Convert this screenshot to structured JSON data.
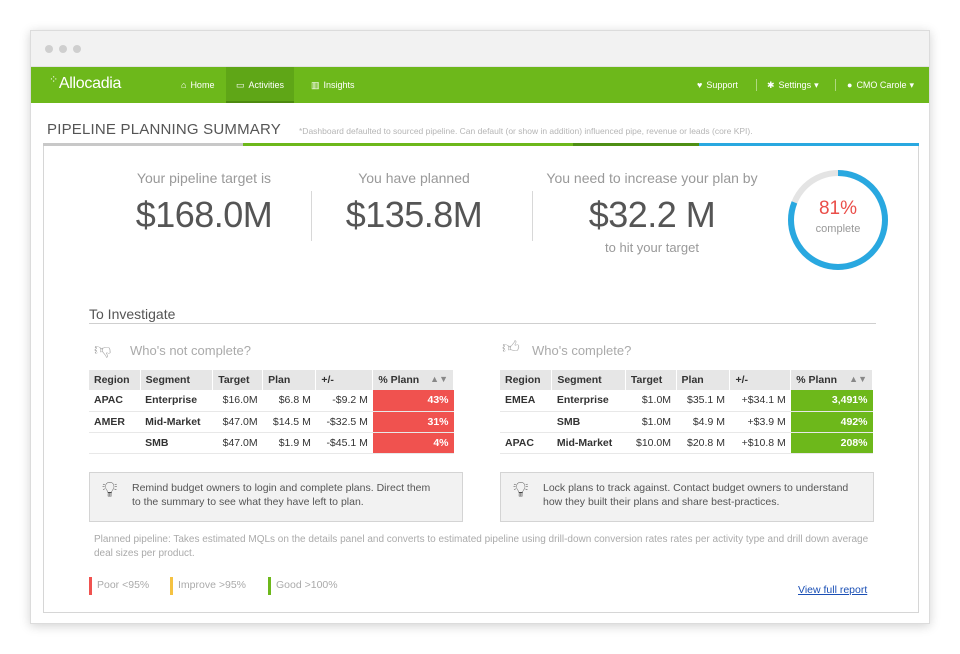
{
  "nav": {
    "logo": "Allocadia",
    "items": [
      {
        "label": "Home",
        "icon": "home-icon"
      },
      {
        "label": "Activities",
        "icon": "monitor-icon"
      },
      {
        "label": "Insights",
        "icon": "bar-chart-icon"
      }
    ],
    "support": "Support",
    "settings": "Settings",
    "user": "CMO Carole"
  },
  "page": {
    "title": "PIPELINE PLANNING SUMMARY",
    "note": "*Dashboard defaulted to sourced pipeline. Can default (or show in addition) influenced pipe, revenue or leads (core KPI)."
  },
  "stats": {
    "target_label": "Your pipeline target is",
    "target_value": "$168.0M",
    "planned_label": "You have planned",
    "planned_value": "$135.8M",
    "increase_label": "You need to increase your plan by",
    "increase_value": "$32.2 M",
    "increase_sub": "to hit your target",
    "complete_pct": "81%",
    "complete_label": "complete",
    "complete_fraction": 0.81
  },
  "investigate": {
    "title": "To Investigate",
    "not_complete": {
      "heading": "Who's not complete?",
      "headers": [
        "Region",
        "Segment",
        "Target",
        "Plan",
        "+/-",
        "% Plann"
      ],
      "rows": [
        [
          "APAC",
          "Enterprise",
          "$16.0M",
          "$6.8 M",
          "-$9.2 M",
          "43%"
        ],
        [
          "AMER",
          "Mid-Market",
          "$47.0M",
          "$14.5 M",
          "-$32.5 M",
          "31%"
        ],
        [
          "",
          "SMB",
          "$47.0M",
          "$1.9 M",
          "-$45.1 M",
          "4%"
        ]
      ],
      "tip": [
        "Remind budget owners to login and complete plans. Direct them",
        "to the summary to see what they have left to plan."
      ]
    },
    "complete": {
      "heading": "Who's complete?",
      "headers": [
        "Region",
        "Segment",
        "Target",
        "Plan",
        "+/-",
        "% Plann"
      ],
      "rows": [
        [
          "EMEA",
          "Enterprise",
          "$1.0M",
          "$35.1 M",
          "+$34.1 M",
          "3,491%"
        ],
        [
          "",
          "SMB",
          "$1.0M",
          "$4.9 M",
          "+$3.9 M",
          "492%"
        ],
        [
          "APAC",
          "Mid-Market",
          "$10.0M",
          "$20.8 M",
          "+$10.8 M",
          "208%"
        ]
      ],
      "tip": [
        "Lock plans to track against. Contact budget owners to understand",
        "how they built their plans and share best-practices."
      ]
    }
  },
  "footnote": "Planned pipeline: Takes estimated MQLs on the details panel and converts to estimated pipeline using drill-down conversion rates rates per activity type and drill down average deal sizes per product.",
  "legend": [
    {
      "label": "Poor <95%",
      "color": "#f0524f"
    },
    {
      "label": "Improve >95%",
      "color": "#f5c242"
    },
    {
      "label": "Good >100%",
      "color": "#6db81b"
    }
  ],
  "full_report": "View full report",
  "colors": {
    "brand_green": "#6db81b",
    "accent_blue": "#29a8e0",
    "poor_red": "#f0524f"
  }
}
